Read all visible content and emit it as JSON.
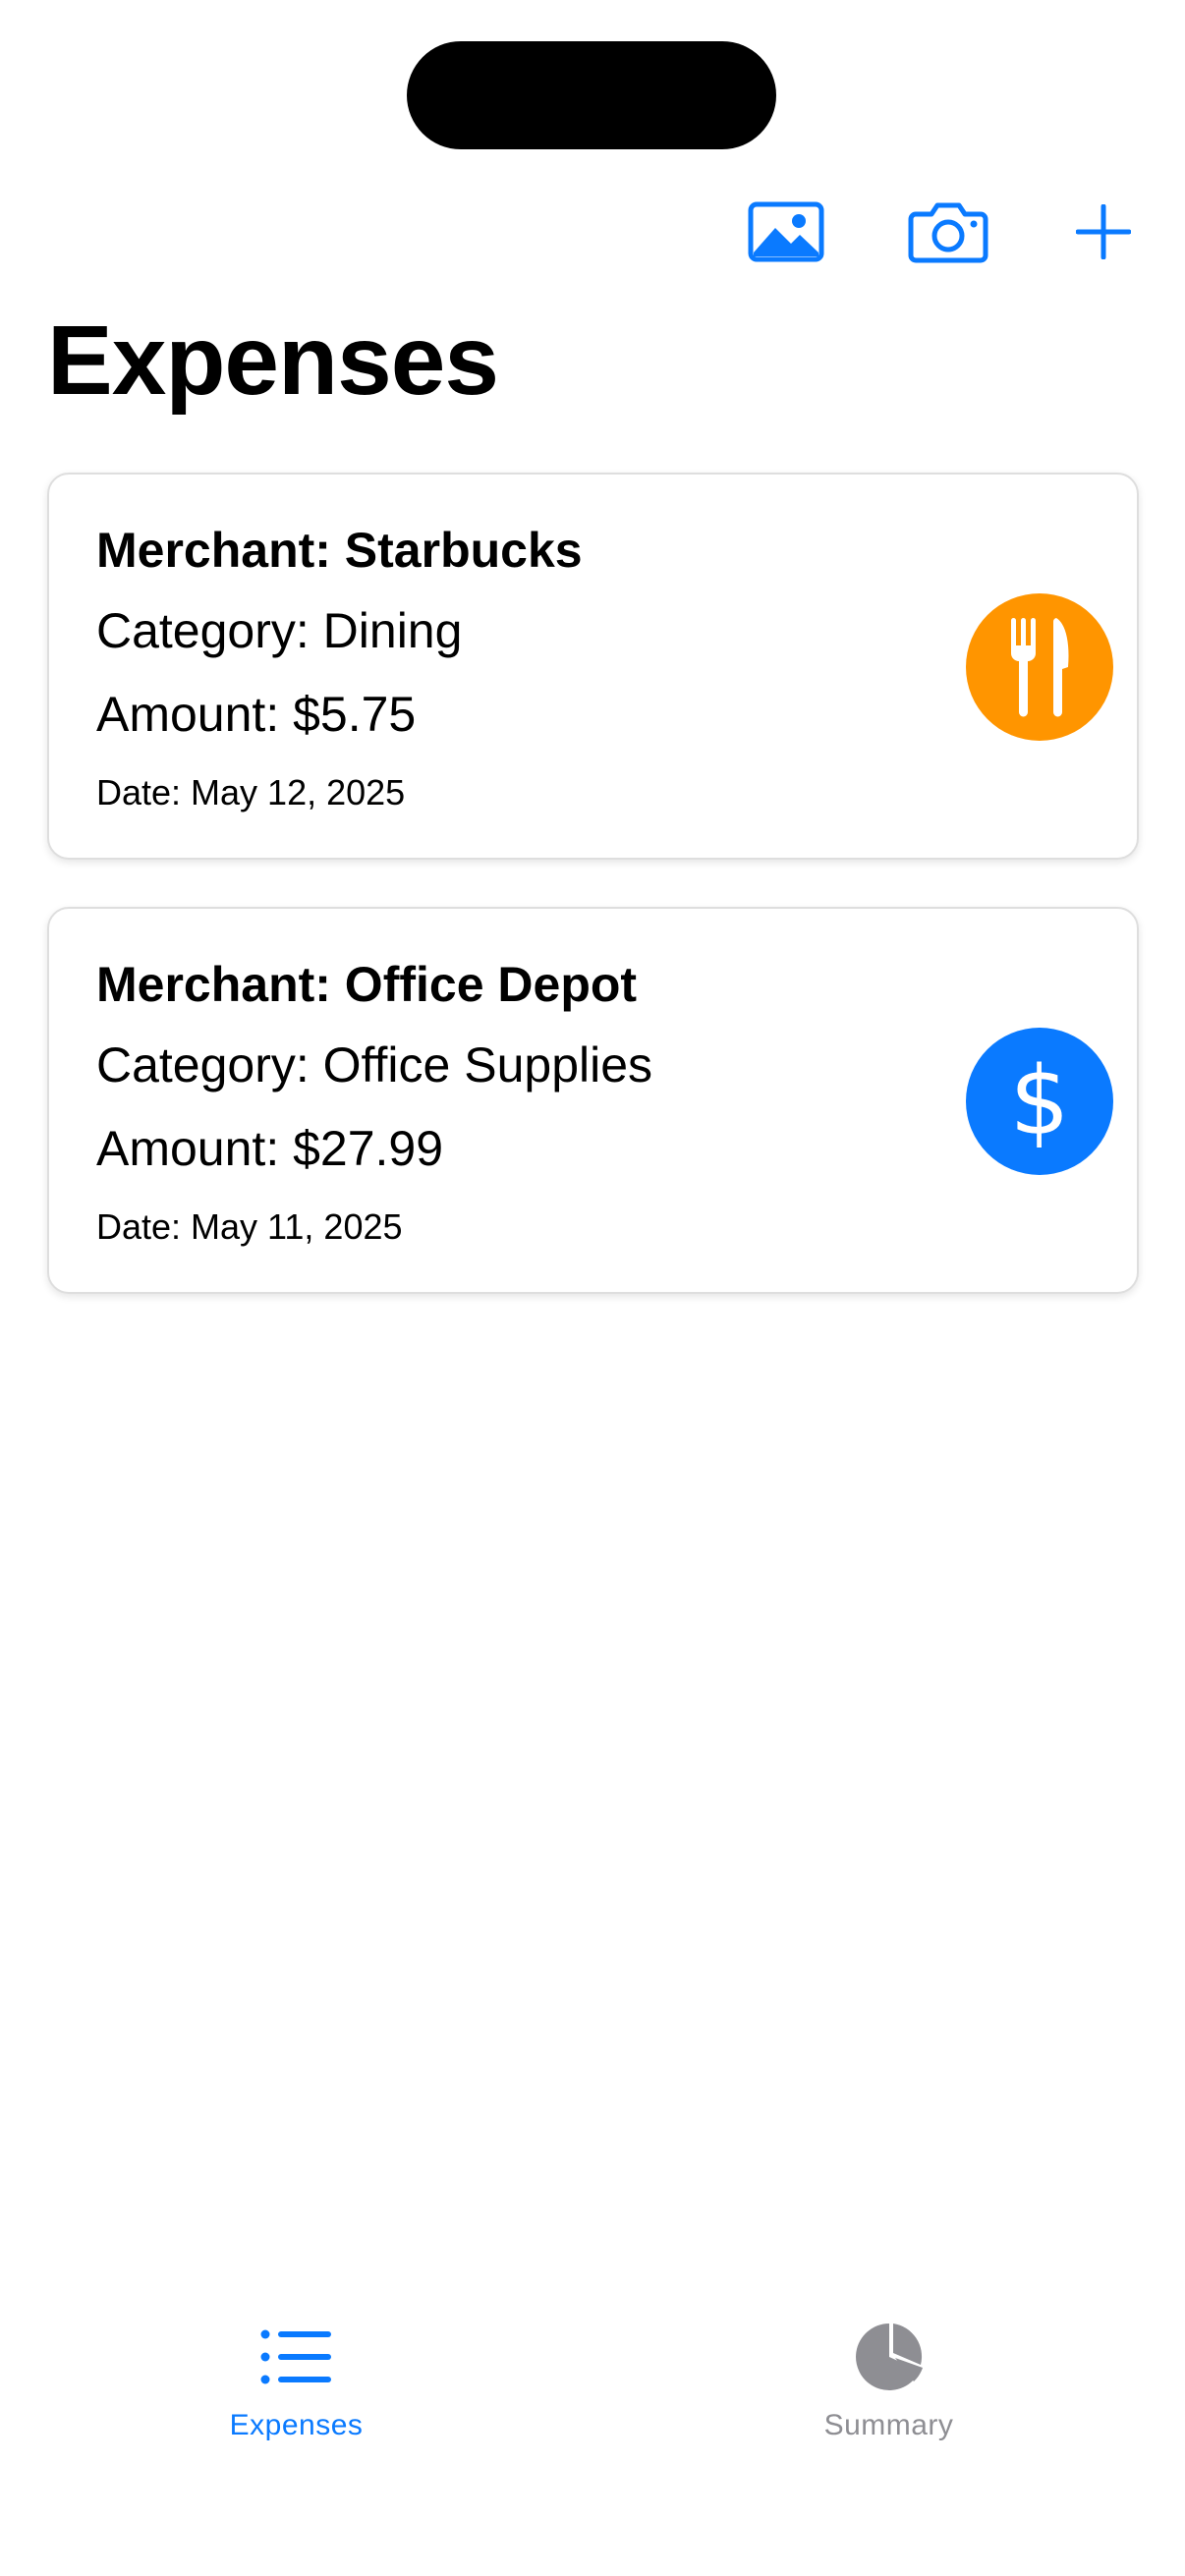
{
  "title": "Expenses",
  "toolbar": {
    "photo_icon": "photo-icon",
    "camera_icon": "camera-icon",
    "add_icon": "plus-icon",
    "tint": "#0A7AFF"
  },
  "expenses": [
    {
      "merchant": "Merchant: Starbucks",
      "category": "Category: Dining",
      "amount": "Amount: $5.75",
      "date": "Date: May 12, 2025",
      "icon": "fork-knife-icon",
      "icon_color": "#FF9500"
    },
    {
      "merchant": "Merchant: Office Depot",
      "category": "Category: Office Supplies",
      "amount": "Amount: $27.99",
      "date": "Date: May 11, 2025",
      "icon": "dollar-sign-icon",
      "icon_glyph": "$",
      "icon_color": "#0A7AFF"
    }
  ],
  "tabs": [
    {
      "label": "Expenses",
      "icon": "list-bullet-icon",
      "selected": true,
      "color": "#0A7AFF"
    },
    {
      "label": "Summary",
      "icon": "pie-chart-icon",
      "selected": false,
      "color": "#8E8E93"
    }
  ]
}
